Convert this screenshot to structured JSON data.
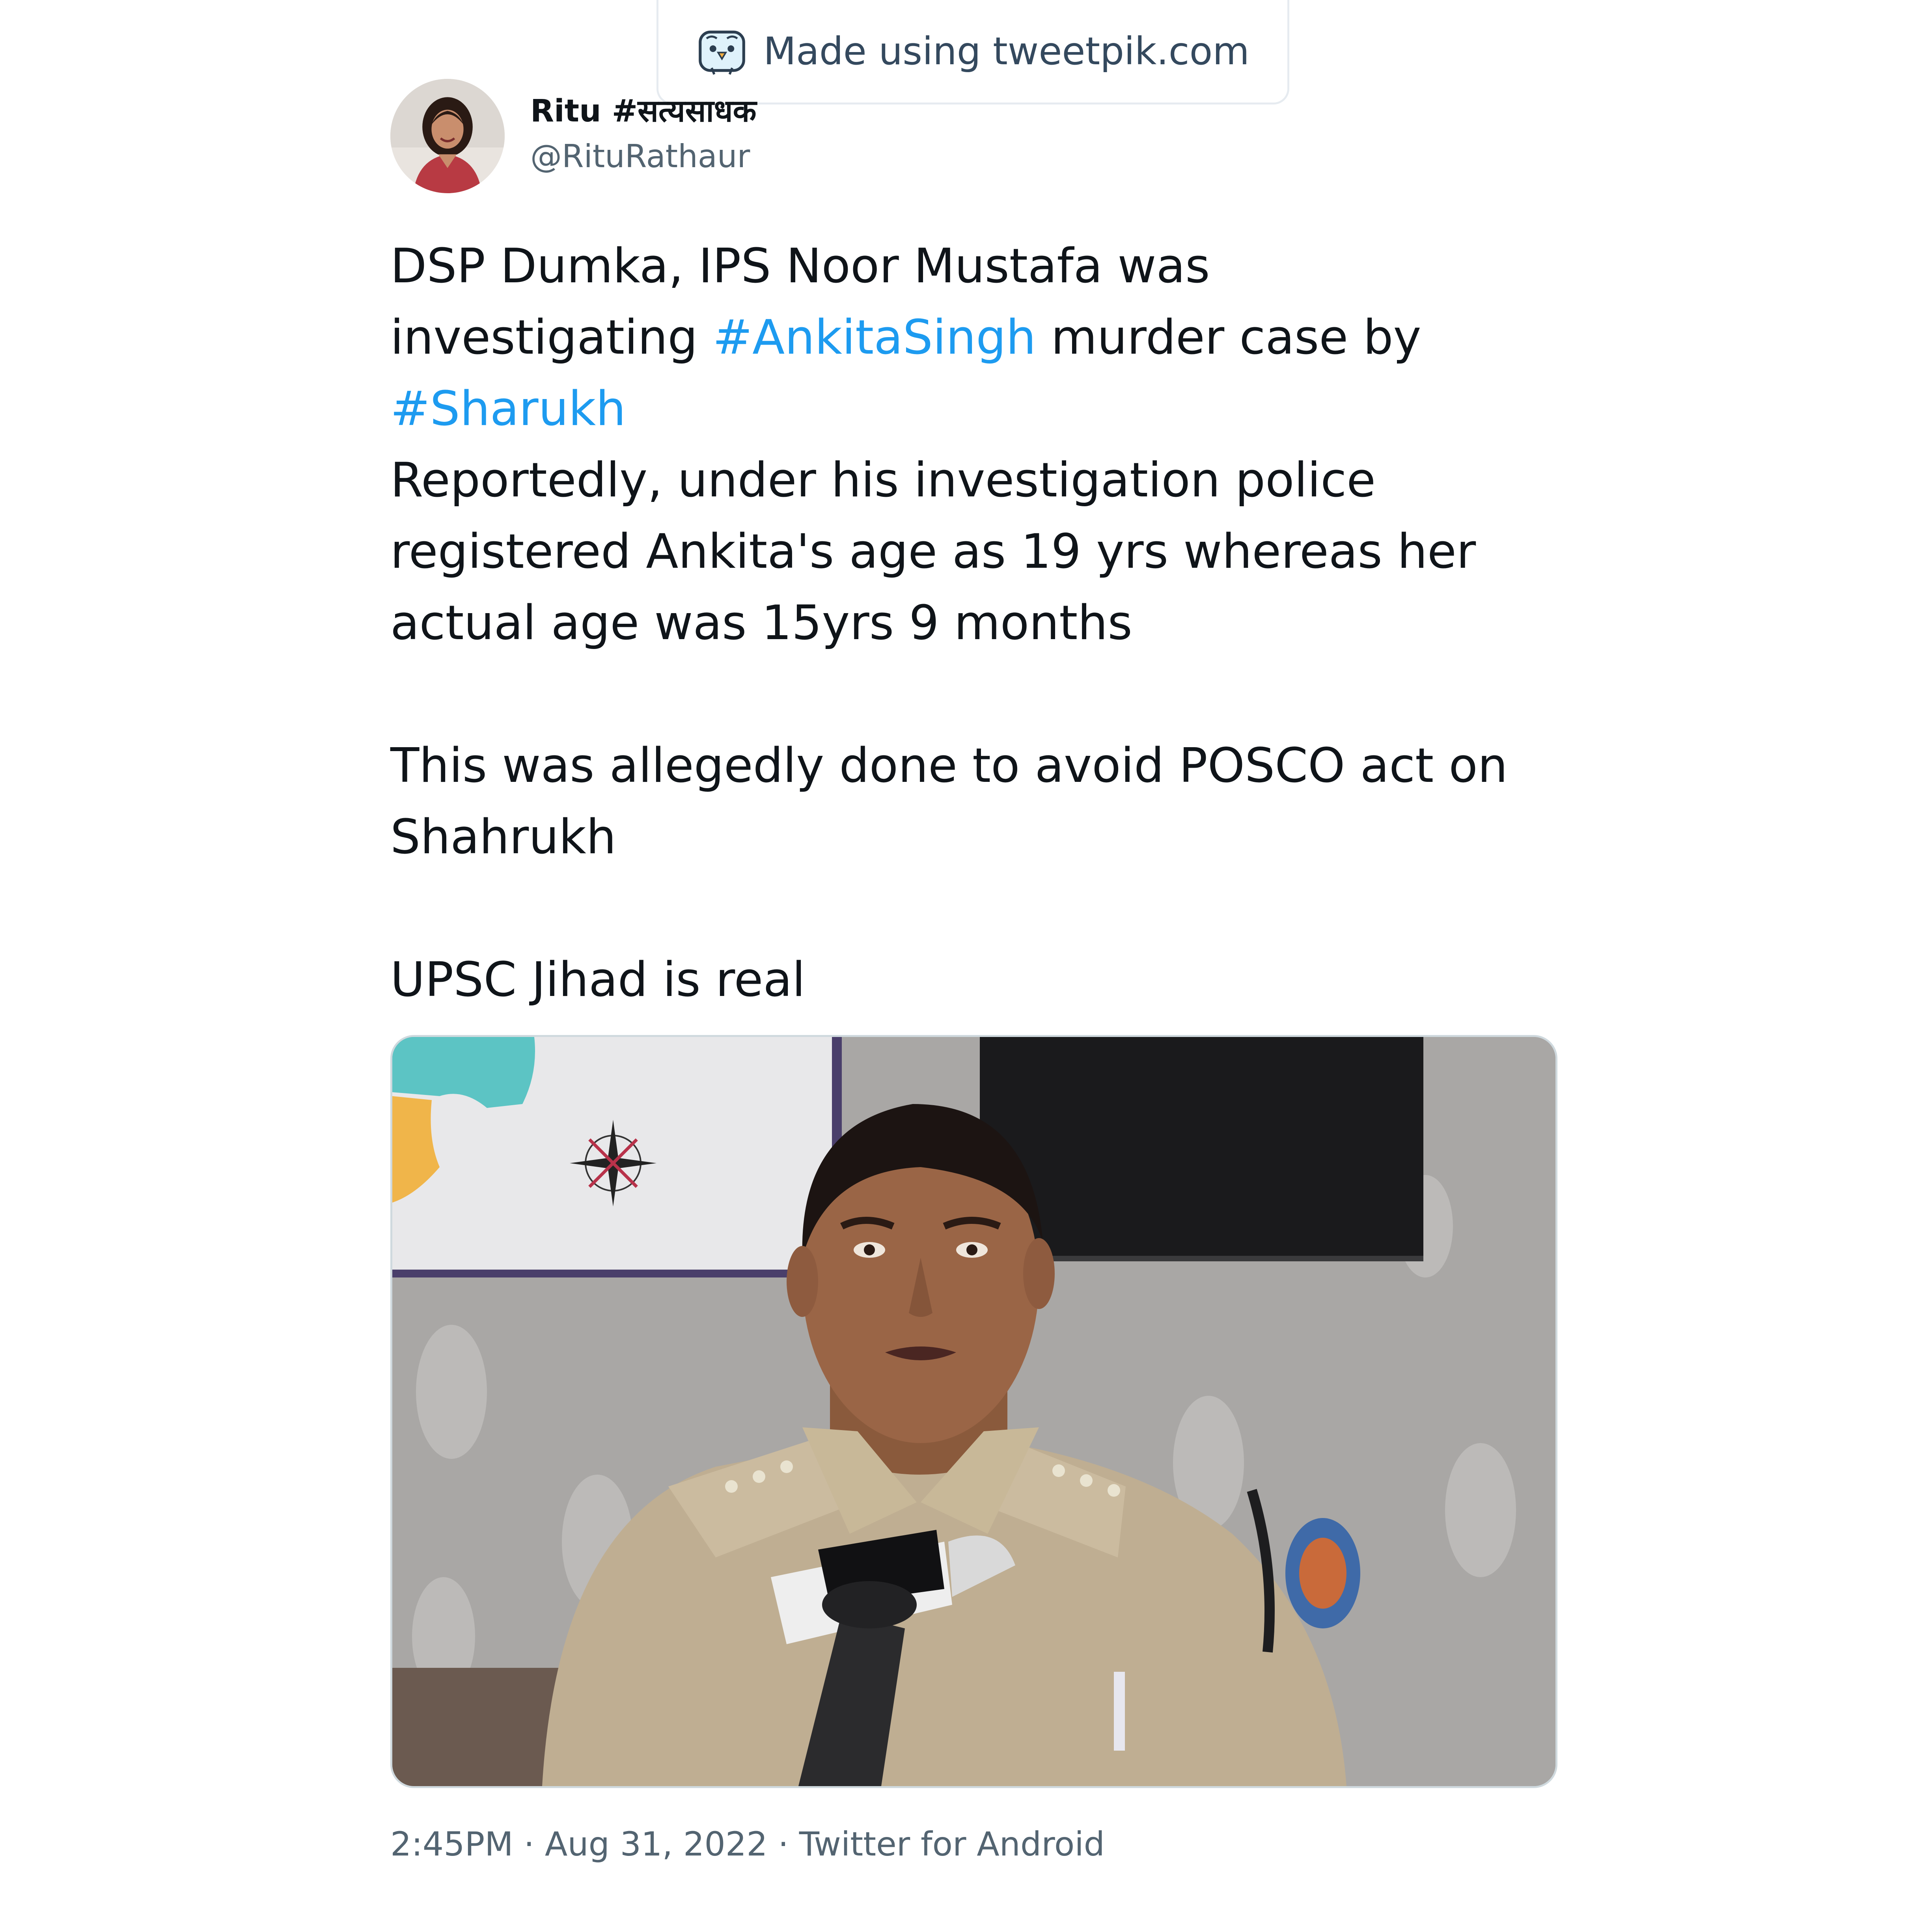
{
  "watermark": {
    "icon": "tweetpik-bird-icon",
    "text": "Made using tweetpik.com"
  },
  "author": {
    "display_name": "Ritu #सत्यसाधक",
    "handle": "@RituRathaur",
    "avatar": "profile-photo"
  },
  "tweet": {
    "line_1": "DSP Dumka, IPS Noor Mustafa was",
    "line_2_pre": "investigating ",
    "line_2_hashtag": "#AnkitaSingh",
    "line_2_post": " murder case by",
    "line_3_hashtag": "#Sharukh",
    "line_4": "Reportedly, under his investigation police",
    "line_5": "registered Ankita's age as 19 yrs whereas her",
    "line_6": "actual age was 15yrs 9 months",
    "line_7": "This was allegedly done to avoid POSCO act on",
    "line_8": "Shahrukh",
    "line_9": "UPSC Jihad is real",
    "hashtag_color": "#1d9bf0"
  },
  "media": {
    "type": "photo",
    "subject": "police-officer-speaking-into-microphones"
  },
  "footer": {
    "time": "2:45PM",
    "separator_1": " · ",
    "date": "Aug 31, 2022",
    "separator_2": " · ",
    "source": "Twitter for Android"
  }
}
